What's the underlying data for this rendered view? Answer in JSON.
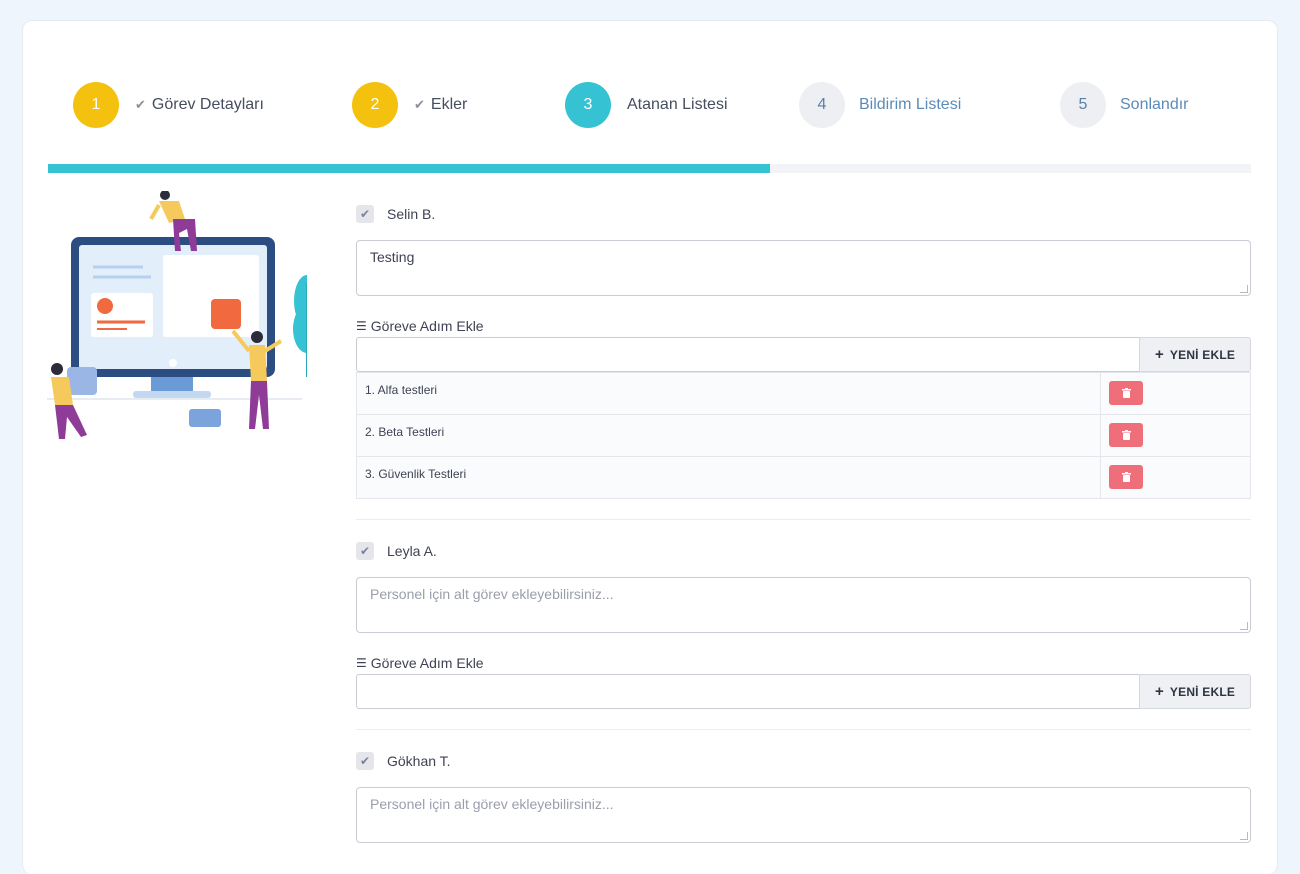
{
  "wizard": {
    "steps": [
      {
        "number": "1",
        "label": "Görev Detayları",
        "state": "done"
      },
      {
        "number": "2",
        "label": "Ekler",
        "state": "done"
      },
      {
        "number": "3",
        "label": "Atanan Listesi",
        "state": "active"
      },
      {
        "number": "4",
        "label": "Bildirim Listesi",
        "state": "pending"
      },
      {
        "number": "5",
        "label": "Sonlandır",
        "state": "pending"
      }
    ],
    "progress_fraction": 0.6,
    "colors": {
      "done": "#f4c10e",
      "active": "#35c3d3",
      "pending": "#eeeff2"
    }
  },
  "assignees": [
    {
      "name": "Selin B.",
      "note_value": "Testing",
      "steps_title": "Göreve Adım Ekle",
      "add_button": "YENİ EKLE",
      "tasks": [
        "1. Alfa testleri",
        "2. Beta Testleri",
        "3. Güvenlik Testleri"
      ]
    },
    {
      "name": "Leyla A.",
      "note_placeholder": "Personel için alt görev ekleyebilirsiniz...",
      "steps_title": "Göreve Adım Ekle",
      "add_button": "YENİ EKLE"
    },
    {
      "name": "Gökhan T.",
      "note_placeholder": "Personel için alt görev ekleyebilirsiniz..."
    }
  ],
  "icons": {
    "checkbox": "check-icon",
    "steps": "list-icon",
    "add": "plus-icon",
    "delete": "trash-icon"
  }
}
